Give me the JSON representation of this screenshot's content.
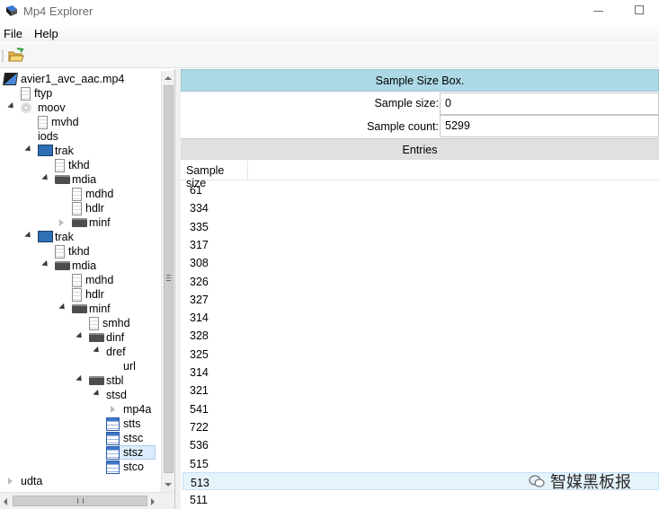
{
  "window": {
    "title": "Mp4 Explorer"
  },
  "menu": {
    "items": [
      "File",
      "Help"
    ]
  },
  "toolbar": {
    "open_icon": "open-folder-icon"
  },
  "tree": {
    "nodes": [
      {
        "label": "avier1_avc_aac.mp4",
        "icon": "mp4-file-icon"
      },
      {
        "label": "ftyp",
        "icon": "document-icon"
      },
      {
        "label": "moov",
        "icon": "disc-icon"
      },
      {
        "label": "mvhd",
        "icon": "document-icon"
      },
      {
        "label": "iods",
        "icon": "none"
      },
      {
        "label": "trak",
        "icon": "monitor-icon"
      },
      {
        "label": "tkhd",
        "icon": "document-icon"
      },
      {
        "label": "mdia",
        "icon": "folder-icon"
      },
      {
        "label": "mdhd",
        "icon": "document-icon"
      },
      {
        "label": "hdlr",
        "icon": "document-icon"
      },
      {
        "label": "minf",
        "icon": "folder-icon"
      },
      {
        "label": "trak",
        "icon": "monitor-icon"
      },
      {
        "label": "tkhd",
        "icon": "document-icon"
      },
      {
        "label": "mdia",
        "icon": "folder-icon"
      },
      {
        "label": "mdhd",
        "icon": "document-icon"
      },
      {
        "label": "hdlr",
        "icon": "document-icon"
      },
      {
        "label": "minf",
        "icon": "folder-icon"
      },
      {
        "label": "smhd",
        "icon": "document-icon"
      },
      {
        "label": "dinf",
        "icon": "folder-icon"
      },
      {
        "label": "dref",
        "icon": "none"
      },
      {
        "label": "url",
        "icon": "none"
      },
      {
        "label": "stbl",
        "icon": "folder-icon"
      },
      {
        "label": "stsd",
        "icon": "none"
      },
      {
        "label": "mp4a",
        "icon": "none"
      },
      {
        "label": "stts",
        "icon": "table-icon"
      },
      {
        "label": "stsc",
        "icon": "table-icon"
      },
      {
        "label": "stsz",
        "icon": "table-icon",
        "selected": true
      },
      {
        "label": "stco",
        "icon": "table-icon"
      },
      {
        "label": "udta",
        "icon": "none"
      }
    ]
  },
  "detail": {
    "header": "Sample Size Box.",
    "sample_size_label": "Sample size:",
    "sample_size_value": "0",
    "sample_count_label": "Sample count:",
    "sample_count_value": "5299",
    "entries_header": "Entries",
    "column_header": "Sample size",
    "entries": [
      "61",
      "334",
      "335",
      "317",
      "308",
      "326",
      "327",
      "314",
      "328",
      "325",
      "314",
      "321",
      "541",
      "722",
      "536",
      "515",
      "513",
      "511"
    ],
    "selected_entry": "513"
  },
  "watermark": {
    "text": "智媒黑板报"
  }
}
